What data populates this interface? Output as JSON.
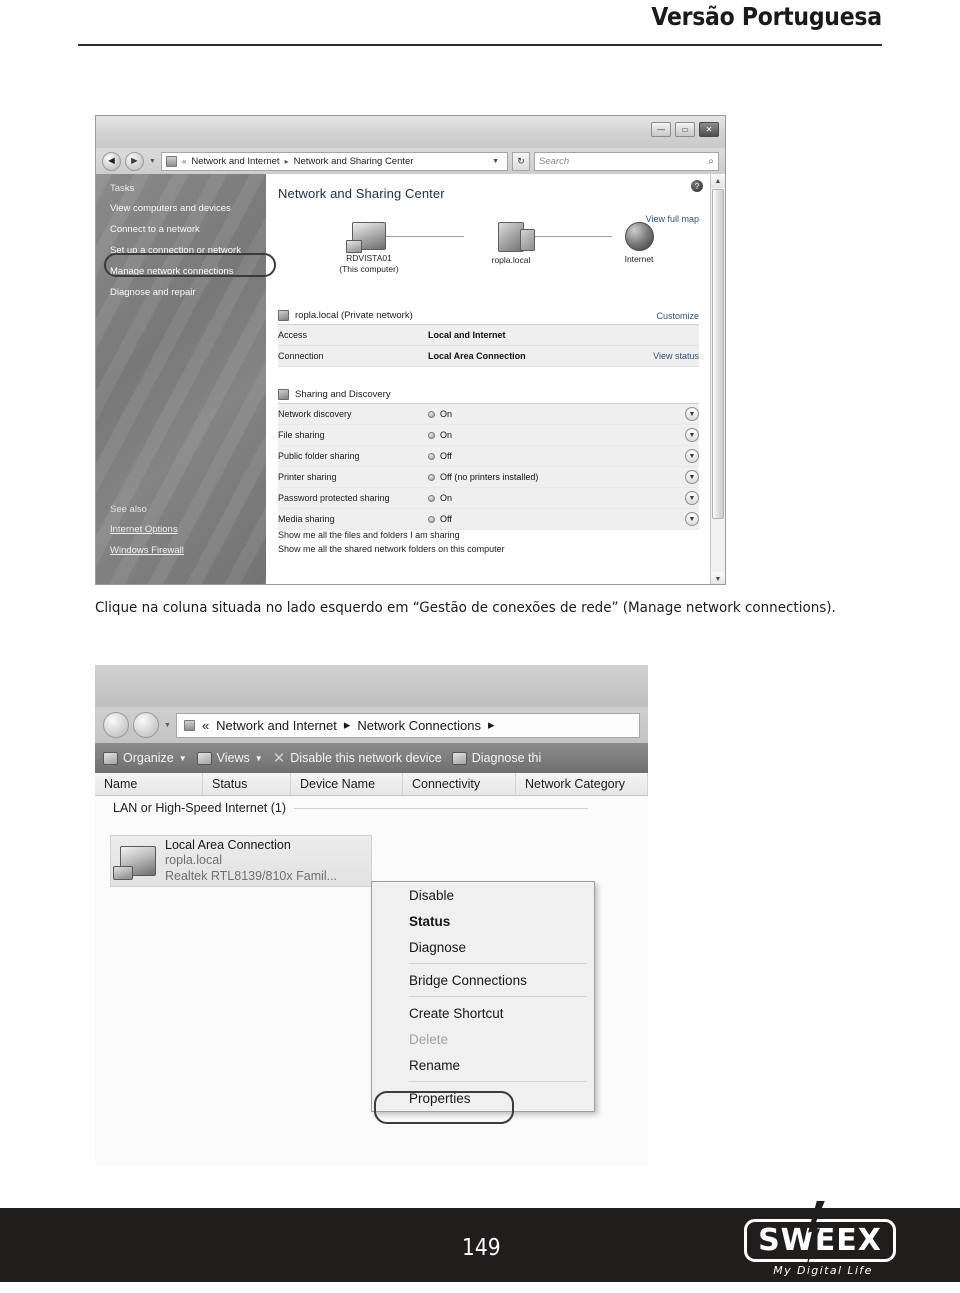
{
  "header": {
    "title": "Versão Portuguesa"
  },
  "window1": {
    "nav": {
      "back_icon": "back-arrow-icon",
      "forward_icon": "forward-arrow-icon",
      "address_chevron": "double-chevron-left",
      "crumb1": "Network and Internet",
      "crumb_sep": "▸",
      "crumb2": "Network and Sharing Center",
      "dropdown_icon": "▼",
      "refresh_icon": "↻",
      "search_placeholder": "Search",
      "search_icon": "search-icon"
    },
    "window_buttons": {
      "minimize": "—",
      "maximize": "▭",
      "close": "✕"
    },
    "sidebar": {
      "tasks_heading": "Tasks",
      "items": [
        {
          "label": "View computers and devices"
        },
        {
          "label": "Connect to a network"
        },
        {
          "label": "Set up a connection or network"
        },
        {
          "label": "Manage network connections"
        },
        {
          "label": "Diagnose and repair"
        }
      ],
      "see_also_heading": "See also",
      "see_also": [
        {
          "label": "Internet Options"
        },
        {
          "label": "Windows Firewall"
        }
      ]
    },
    "content": {
      "title": "Network and Sharing Center",
      "view_full_map": "View full map",
      "map_nodes": [
        {
          "label": "RDVISTA01",
          "sub": "(This computer)",
          "icon": "computer-icon"
        },
        {
          "label": "ropla.local",
          "sub": "",
          "icon": "server-icon"
        },
        {
          "label": "Internet",
          "sub": "",
          "icon": "globe-icon"
        }
      ],
      "network_section": {
        "title": "ropla.local (Private network)",
        "customize": "Customize",
        "rows": [
          {
            "key": "Access",
            "value": "Local and Internet",
            "right": ""
          },
          {
            "key": "Connection",
            "value": "Local Area Connection",
            "right": "View status"
          }
        ]
      },
      "sharing_section": {
        "title": "Sharing and Discovery",
        "rows": [
          {
            "key": "Network discovery",
            "state": "On"
          },
          {
            "key": "File sharing",
            "state": "On"
          },
          {
            "key": "Public folder sharing",
            "state": "Off"
          },
          {
            "key": "Printer sharing",
            "state": "Off (no printers installed)"
          },
          {
            "key": "Password protected sharing",
            "state": "On"
          },
          {
            "key": "Media sharing",
            "state": "Off"
          }
        ]
      },
      "show_links": [
        "Show me all the files and folders I am sharing",
        "Show me all the shared network folders on this computer"
      ]
    }
  },
  "caption": "Clique na coluna situada no lado esquerdo em “Gestão de conexões de rede” (Manage network connections).",
  "window2": {
    "nav": {
      "crumb_chevron": "«",
      "crumb1": "Network and Internet",
      "sep1": "▸",
      "crumb2": "Network Connections",
      "sep2": "▸"
    },
    "toolbar": [
      {
        "label": "Organize",
        "caret": "▼",
        "icon": "organize-icon"
      },
      {
        "label": "Views",
        "caret": "▼",
        "icon": "views-icon"
      },
      {
        "label": "Disable this network device",
        "caret": "",
        "icon": "disable-x-icon"
      },
      {
        "label": "Diagnose thi",
        "caret": "",
        "icon": "diagnose-icon"
      }
    ],
    "columns": [
      "Name",
      "Status",
      "Device Name",
      "Connectivity",
      "Network Category"
    ],
    "group_label": "LAN or High-Speed Internet (1)",
    "connection": {
      "name": "Local Area Connection",
      "network": "ropla.local",
      "device": "Realtek RTL8139/810x Famil..."
    },
    "context_menu": [
      {
        "label": "Disable",
        "style": "normal"
      },
      {
        "label": "Status",
        "style": "bold"
      },
      {
        "label": "Diagnose",
        "style": "normal"
      },
      {
        "label": "---",
        "style": "sep"
      },
      {
        "label": "Bridge Connections",
        "style": "normal"
      },
      {
        "label": "---",
        "style": "sep"
      },
      {
        "label": "Create Shortcut",
        "style": "normal"
      },
      {
        "label": "Delete",
        "style": "disabled"
      },
      {
        "label": "Rename",
        "style": "normal"
      },
      {
        "label": "---",
        "style": "sep"
      },
      {
        "label": "Properties",
        "style": "normal"
      }
    ]
  },
  "footer": {
    "page_number": "149",
    "logo_text": "SWEEX",
    "logo_tagline": "My  Digital  Life"
  }
}
